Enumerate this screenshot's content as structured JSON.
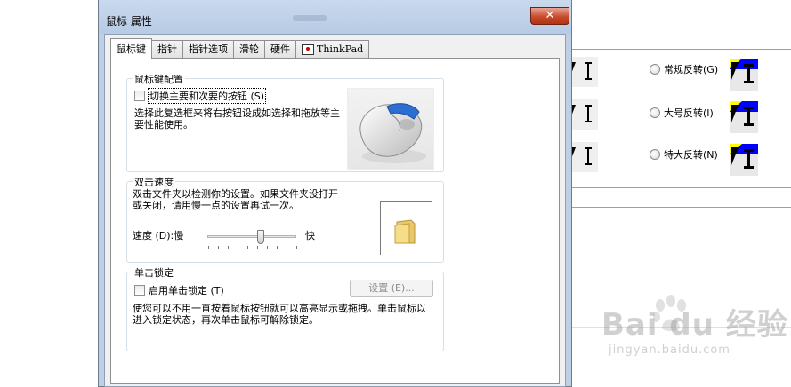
{
  "window": {
    "title": "鼠标 属性",
    "close_label": "✕"
  },
  "tabs": [
    {
      "label": "鼠标键"
    },
    {
      "label": "指针"
    },
    {
      "label": "指针选项"
    },
    {
      "label": "滑轮"
    },
    {
      "label": "硬件"
    },
    {
      "label": "ThinkPad"
    }
  ],
  "button_config": {
    "title": "鼠标键配置",
    "checkbox_label": "切换主要和次要的按钮 (S)",
    "description": "选择此复选框来将右按钮设成如选择和拖放等主要性能使用。"
  },
  "double_click": {
    "title": "双击速度",
    "description": "双击文件夹以检测你的设置。如果文件夹没打开或关闭，请用慢一点的设置再试一次。",
    "speed_label": "速度 (D):慢",
    "fast_label": "快"
  },
  "click_lock": {
    "title": "单击锁定",
    "checkbox_label": "启用单击锁定 (T)",
    "settings_button": "设置 (E)...",
    "description": "使您可以不用一直按着鼠标按钮就可以高亮显示或拖拽。单击鼠标以进入锁定状态，再次单击鼠标可解除锁定。"
  },
  "background_schemes": [
    {
      "label": "常规反转(G)"
    },
    {
      "label": "大号反转(I)"
    },
    {
      "label": "特大反转(N)"
    }
  ],
  "watermark": {
    "brand": "Bai du 经验",
    "url": "jingyan.baidu.com"
  }
}
